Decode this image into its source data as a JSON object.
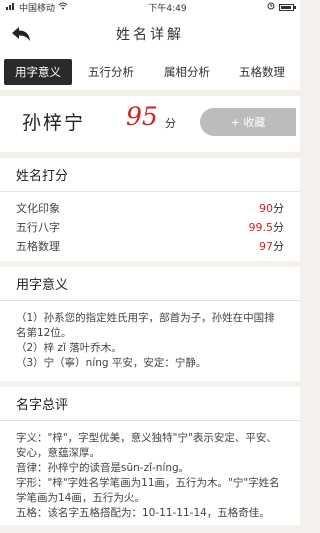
{
  "statusbar": {
    "carrier": "中国移动",
    "time": "下午4:49",
    "battery_level": 0.85
  },
  "header": {
    "title": "姓名详解"
  },
  "tabs": [
    {
      "label": "用字意义",
      "active": true
    },
    {
      "label": "五行分析",
      "active": false
    },
    {
      "label": "属相分析",
      "active": false
    },
    {
      "label": "五格数理",
      "active": false
    }
  ],
  "namecard": {
    "name": "孙梓宁",
    "score": "95",
    "unit": "分",
    "collect_label": "+ 收藏"
  },
  "scoring": {
    "title": "姓名打分",
    "items": [
      {
        "label": "文化印象",
        "value": "90",
        "unit": "分"
      },
      {
        "label": "五行八字",
        "value": "99.5",
        "unit": "分"
      },
      {
        "label": "五格数理",
        "value": "97",
        "unit": "分"
      }
    ]
  },
  "meaning": {
    "title": "用字意义",
    "lines": [
      "（1）孙系您的指定姓氏用字，部首为子，孙姓在中国排名第12位。",
      "（2）梓 zǐ 落叶乔木。",
      "（3）宁（寧）níng 平安，安定：宁静。"
    ]
  },
  "review": {
    "title": "名字总评",
    "lines": [
      "字义：\"梓\"，字型优美，意义独特\"宁\"表示安定、平安、安心，意蕴深厚。",
      "音律：孙梓宁的读音是sūn-zǐ-níng。",
      "字形：\"梓\"字姓名学笔画为11画，五行为木。\"宁\"字姓名学笔画为14画，五行为火。",
      "五格：该名字五格搭配为：10-11-11-14，五格奇佳。"
    ]
  },
  "colors": {
    "accent_red": "#d21f1f",
    "tab_active_bg": "#2a2a2a",
    "page_bg": "#f4f1ec"
  }
}
